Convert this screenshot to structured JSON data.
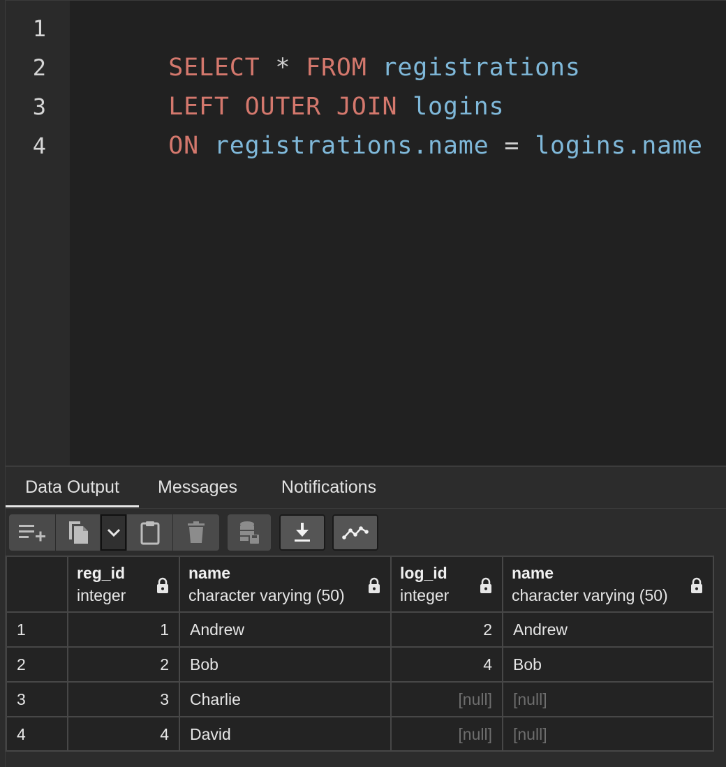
{
  "editor": {
    "line_numbers": [
      "1",
      "2",
      "3",
      "4"
    ],
    "lines": [
      [
        {
          "text": "SELECT",
          "kind": "keyword"
        },
        {
          "text": " * ",
          "kind": "operator"
        },
        {
          "text": "FROM",
          "kind": "keyword"
        },
        {
          "text": " registrations",
          "kind": "identifier"
        }
      ],
      [
        {
          "text": "LEFT OUTER JOIN",
          "kind": "keyword"
        },
        {
          "text": " logins",
          "kind": "identifier"
        }
      ],
      [
        {
          "text": "ON",
          "kind": "keyword"
        },
        {
          "text": " registrations.name",
          "kind": "identifier"
        },
        {
          "text": " = ",
          "kind": "operator"
        },
        {
          "text": "logins.name",
          "kind": "identifier"
        }
      ],
      []
    ],
    "colors": {
      "keyword": "#d4786d",
      "identifier": "#7fb8d9",
      "operator": "#cfcfcf"
    }
  },
  "tabs": [
    {
      "label": "Data Output",
      "active": true
    },
    {
      "label": "Messages",
      "active": false
    },
    {
      "label": "Notifications",
      "active": false
    }
  ],
  "toolbar": {
    "buttons": [
      {
        "icon": "add-row-icon"
      },
      {
        "icon": "copy-icon"
      },
      {
        "icon": "chevron-down-icon"
      },
      {
        "icon": "paste-icon"
      },
      {
        "icon": "delete-icon"
      },
      {
        "icon": "save-data-icon"
      },
      {
        "icon": "download-icon"
      },
      {
        "icon": "graph-icon"
      }
    ]
  },
  "grid": {
    "columns": [
      {
        "name": "reg_id",
        "type": "integer",
        "numeric": true
      },
      {
        "name": "name",
        "type": "character varying (50)",
        "numeric": false
      },
      {
        "name": "log_id",
        "type": "integer",
        "numeric": true
      },
      {
        "name": "name",
        "type": "character varying (50)",
        "numeric": false
      }
    ],
    "rows": [
      {
        "num": "1",
        "cells": [
          "1",
          "Andrew",
          "2",
          "Andrew"
        ]
      },
      {
        "num": "2",
        "cells": [
          "2",
          "Bob",
          "4",
          "Bob"
        ]
      },
      {
        "num": "3",
        "cells": [
          "3",
          "Charlie",
          "[null]",
          "[null]"
        ]
      },
      {
        "num": "4",
        "cells": [
          "4",
          "David",
          "[null]",
          "[null]"
        ]
      }
    ],
    "null_text": "[null]"
  }
}
